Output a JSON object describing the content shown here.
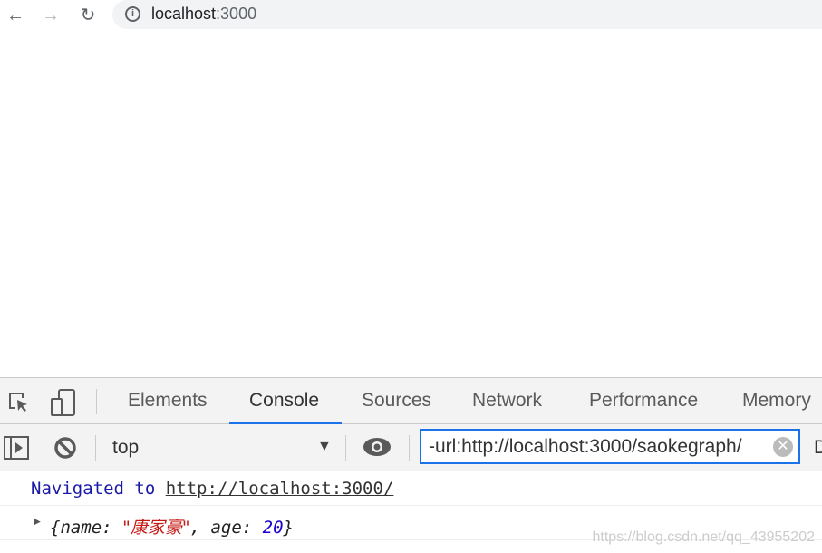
{
  "browser": {
    "url_host": "localhost",
    "url_port": ":3000"
  },
  "devtools": {
    "tabs": [
      {
        "label": "Elements"
      },
      {
        "label": "Console",
        "active": true
      },
      {
        "label": "Sources"
      },
      {
        "label": "Network"
      },
      {
        "label": "Performance"
      },
      {
        "label": "Memory"
      }
    ],
    "context": "top",
    "filter_value": "-url:http://localhost:3000/saokegraph/",
    "levels_label": "D",
    "accent": "#1a73e8"
  },
  "console": {
    "nav_prefix": "Navigated to ",
    "nav_url": "http://localhost:3000/",
    "obj_open": "{name: ",
    "obj_name": "\"康家豪\"",
    "obj_mid": ", age: ",
    "obj_age": "20",
    "obj_close": "}"
  },
  "watermark": "https://blog.csdn.net/qq_43955202"
}
